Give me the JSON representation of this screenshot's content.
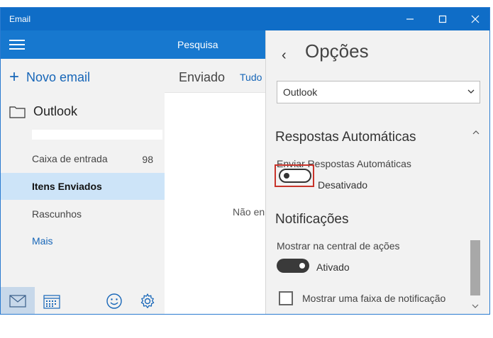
{
  "window": {
    "title": "Email"
  },
  "nav": {
    "new_email": "Novo email",
    "account": "Outlook",
    "folders": [
      {
        "label": "Caixa de entrada",
        "count": "98"
      },
      {
        "label": "Itens Enviados"
      },
      {
        "label": "Rascunhos"
      },
      {
        "label": "Mais"
      }
    ]
  },
  "middle": {
    "search_placeholder": "Pesquisa",
    "folder_title": "Enviado",
    "filter": "Tudo",
    "empty_message": "Não en"
  },
  "options": {
    "title": "Opções",
    "account_select": "Outlook",
    "auto_reply": {
      "section": "Respostas Automáticas",
      "label": "Enviar Respostas Automáticas",
      "state": "Desativado",
      "enabled": false
    },
    "notifications": {
      "section": "Notificações",
      "action_center_label": "Mostrar na central de ações",
      "action_center_state": "Ativado",
      "action_center_enabled": true,
      "banner_label": "Mostrar uma faixa de notificação",
      "banner_checked": false
    }
  },
  "colors": {
    "titlebar": "#0f6dc7",
    "nav_header": "#1778cf",
    "accent_text": "#1766b8",
    "selected_folder": "#cde4f8",
    "highlight_border": "#c8332a"
  },
  "icons": [
    "hamburger-icon",
    "plus-icon",
    "folder-icon",
    "mail-icon",
    "calendar-icon",
    "smiley-icon",
    "gear-icon",
    "back-arrow-icon",
    "chevron-down-icon",
    "chevron-up-icon"
  ]
}
